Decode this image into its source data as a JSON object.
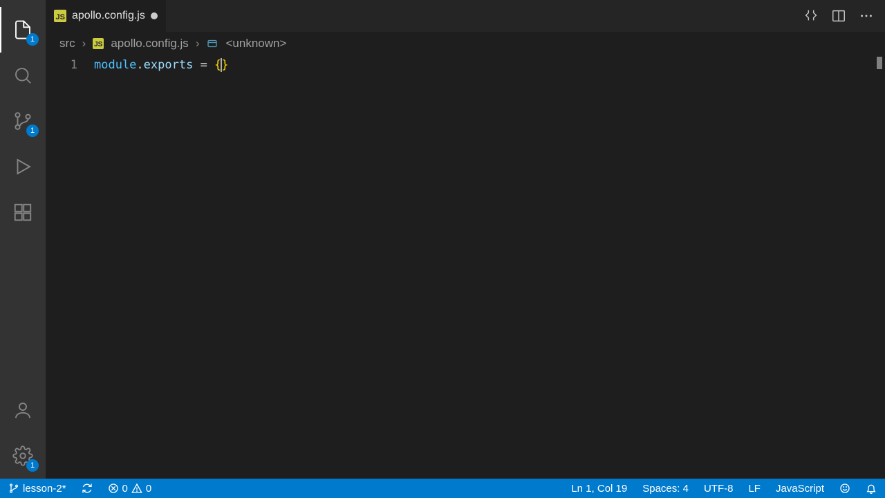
{
  "tab": {
    "filename": "apollo.config.js",
    "dirty": true
  },
  "breadcrumbs": {
    "root": "src",
    "file": "apollo.config.js",
    "symbol": "<unknown>"
  },
  "editor": {
    "line_number": "1",
    "tok_module": "module",
    "tok_dot": ".",
    "tok_exports": "exports",
    "tok_eq": " = ",
    "tok_open": "{",
    "tok_close": "}"
  },
  "activity": {
    "explorer_badge": "1",
    "scm_badge": "1",
    "settings_badge": "1"
  },
  "status": {
    "branch": "lesson-2*",
    "errors": "0",
    "warnings": "0",
    "cursor": "Ln 1, Col 19",
    "indent": "Spaces: 4",
    "encoding": "UTF-8",
    "eol": "LF",
    "language": "JavaScript"
  }
}
